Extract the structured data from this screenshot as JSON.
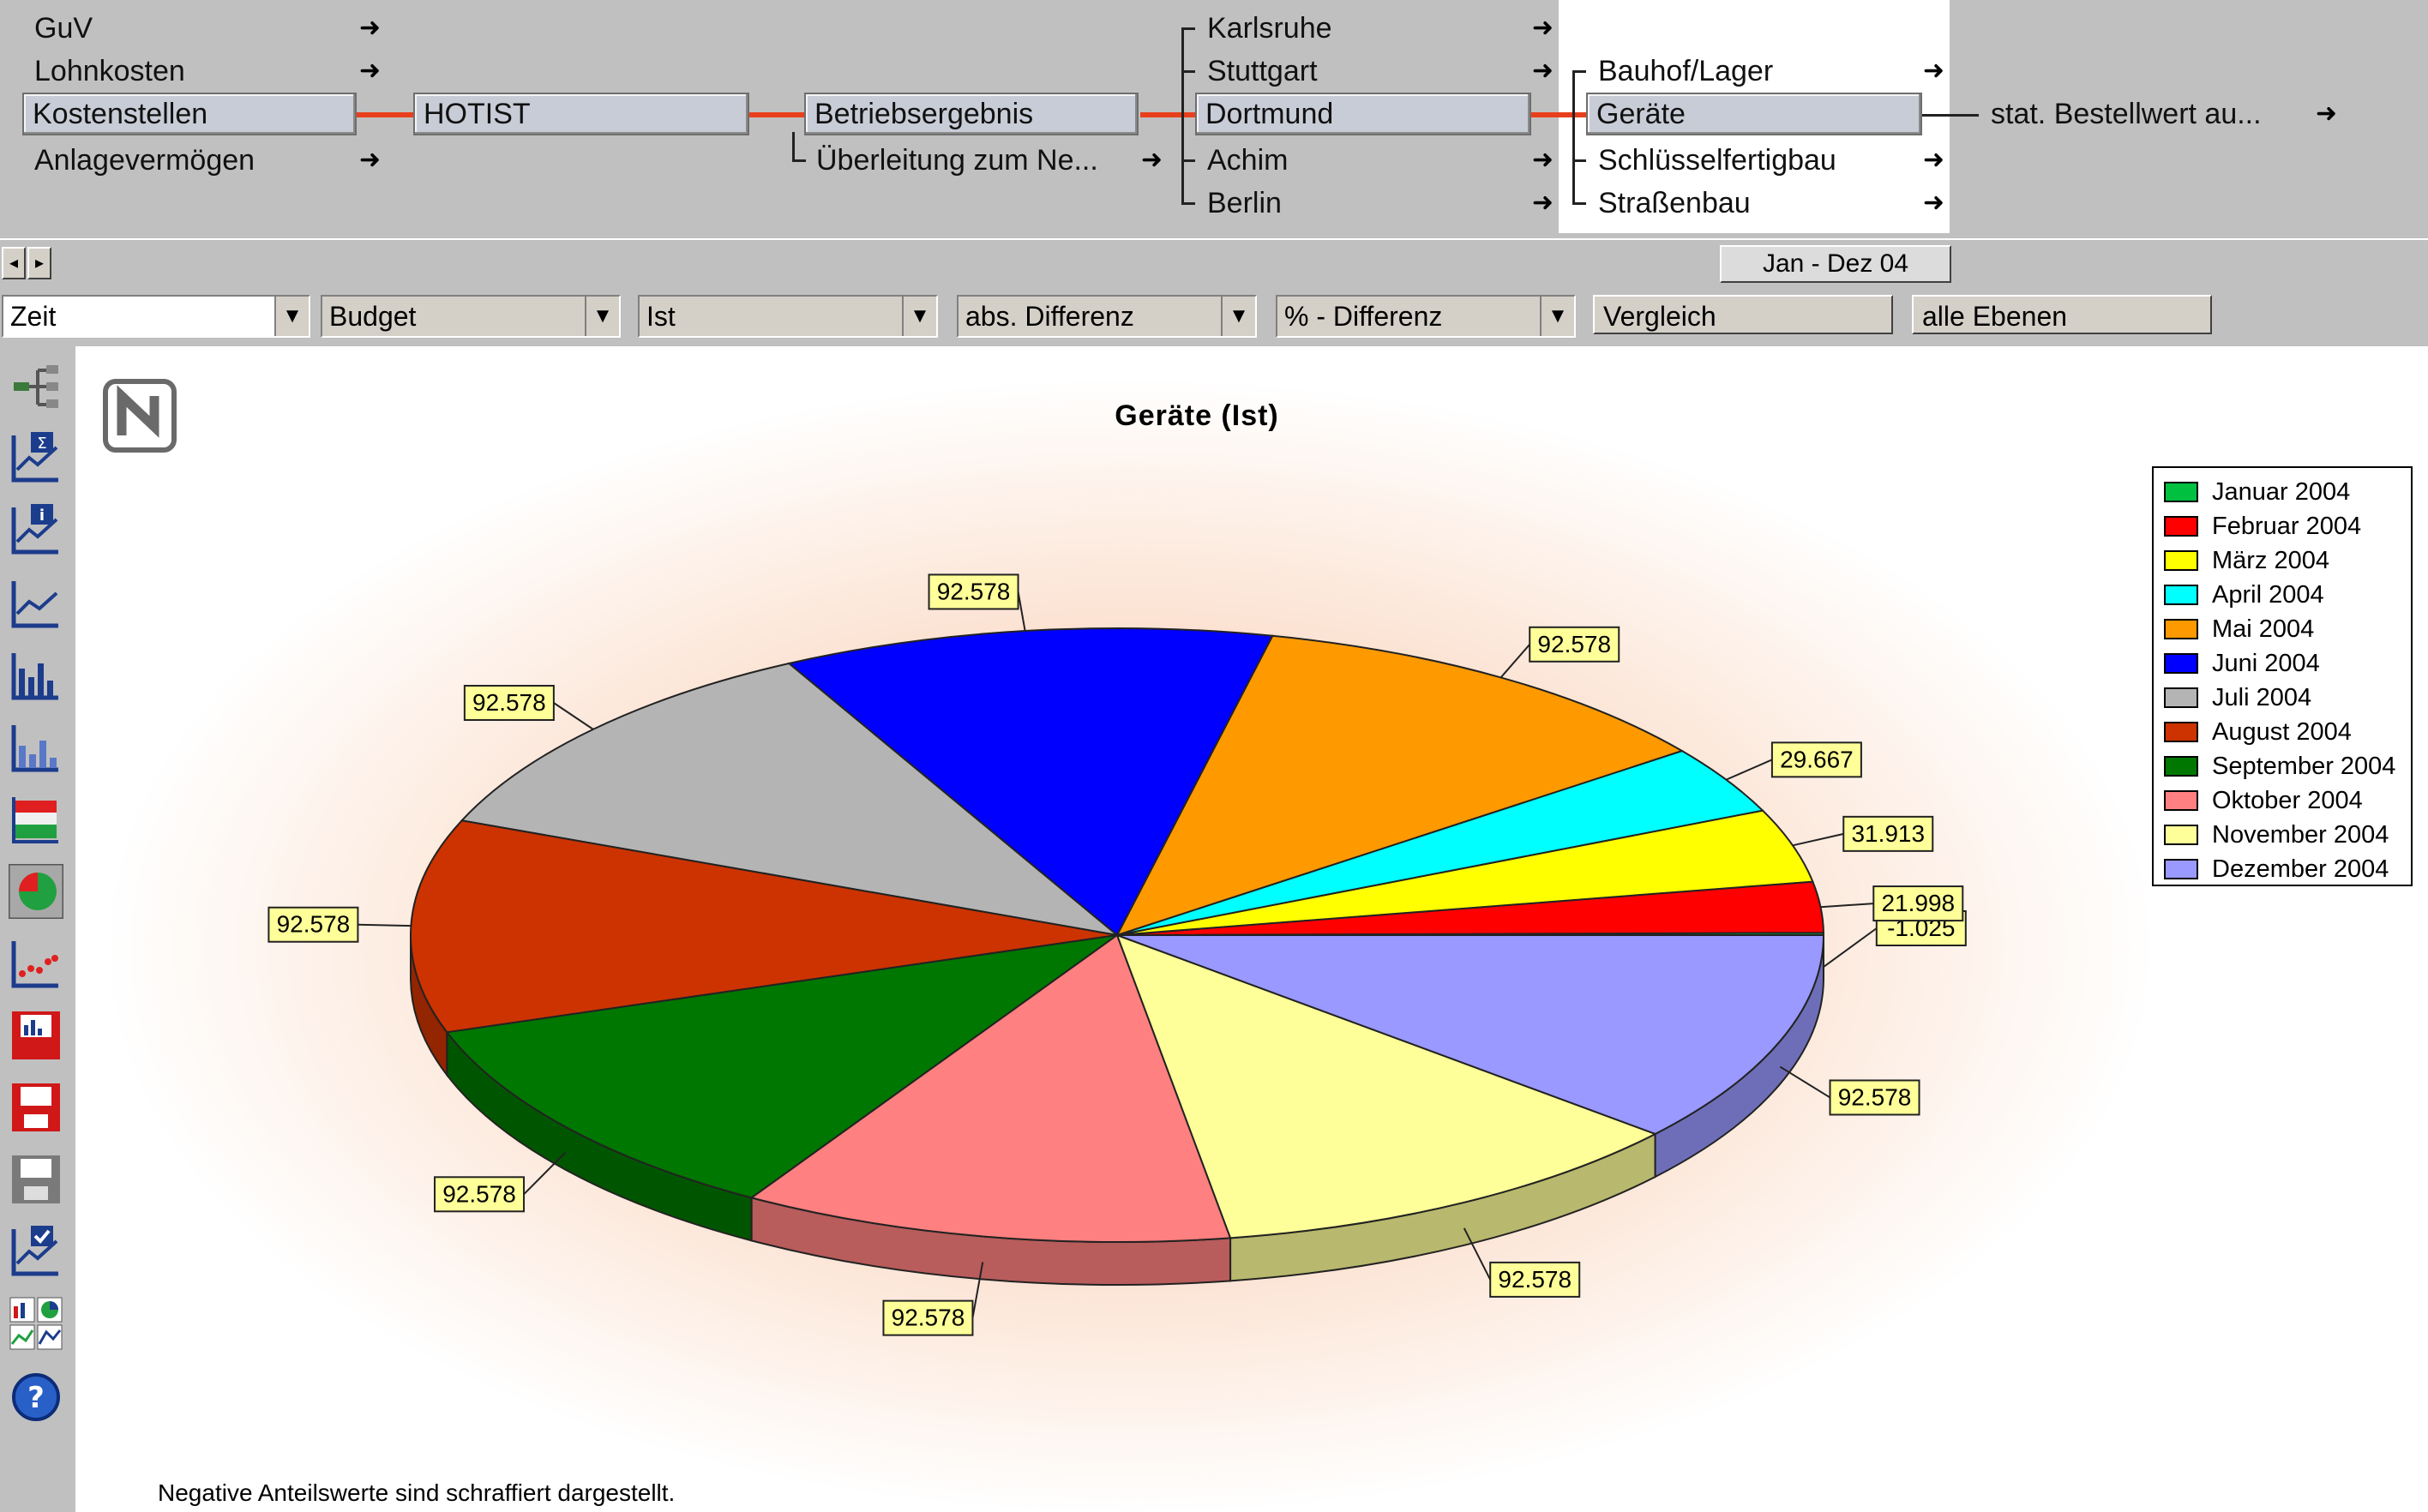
{
  "nav": {
    "col1": [
      {
        "label": "GuV",
        "arrow": true
      },
      {
        "label": "Lohnkosten",
        "arrow": true
      },
      {
        "label": "Kostenstellen",
        "selected": true
      },
      {
        "label": "Anlagevermögen",
        "arrow": true
      }
    ],
    "col2": [
      {
        "label": "HOTIST",
        "selected": true
      }
    ],
    "col3": [
      {
        "label": "Betriebsergebnis",
        "selected": true
      },
      {
        "label": "Überleitung zum Ne...",
        "arrow": true
      }
    ],
    "col4": [
      {
        "label": "Karlsruhe",
        "arrow": true
      },
      {
        "label": "Stuttgart",
        "arrow": true
      },
      {
        "label": "Dortmund",
        "selected": true
      },
      {
        "label": "Achim",
        "arrow": true
      },
      {
        "label": "Berlin",
        "arrow": true
      }
    ],
    "col5": [
      {
        "label": "Bauhof/Lager",
        "arrow": true
      },
      {
        "label": "Geräte",
        "selected": true
      },
      {
        "label": "Schlüsselfertigbau",
        "arrow": true
      },
      {
        "label": "Straßenbau",
        "arrow": true
      }
    ],
    "col6": [
      {
        "label": "stat. Bestellwert au...",
        "arrow": true
      }
    ],
    "arrow_glyph": "➜"
  },
  "date_range": "Jan - Dez 04",
  "toolbar": {
    "dropdowns": [
      {
        "value": "Zeit"
      },
      {
        "value": "Budget"
      },
      {
        "value": "Ist"
      },
      {
        "value": "abs. Differenz"
      },
      {
        "value": "% - Differenz"
      }
    ],
    "buttons": [
      {
        "label": "Vergleich"
      },
      {
        "label": "alle Ebenen"
      }
    ],
    "dropdown_arrow": "▼"
  },
  "palette": [
    {
      "icon": "tree-icon"
    },
    {
      "icon": "chart-sum-icon"
    },
    {
      "icon": "chart-info-icon"
    },
    {
      "icon": "line-chart-icon"
    },
    {
      "icon": "bar-chart-icon"
    },
    {
      "icon": "bar-chart-3d-icon"
    },
    {
      "icon": "stacked-chart-icon"
    },
    {
      "icon": "pie-chart-icon"
    },
    {
      "icon": "scatter-chart-icon"
    },
    {
      "icon": "save-chart-icon"
    },
    {
      "icon": "save-icon"
    },
    {
      "icon": "save-as-icon"
    },
    {
      "icon": "check-chart-icon"
    },
    {
      "icon": "multi-chart-icon"
    },
    {
      "icon": "help-icon"
    }
  ],
  "chart_data": {
    "type": "pie",
    "title": "Geräte (Ist)",
    "categories": [
      "Januar 2004",
      "Februar 2004",
      "März 2004",
      "April 2004",
      "Mai 2004",
      "Juni 2004",
      "Juli 2004",
      "August 2004",
      "September 2004",
      "Oktober 2004",
      "November 2004",
      "Dezember 2004"
    ],
    "values": [
      -1.025,
      21.998,
      31.913,
      29.667,
      92.578,
      92.578,
      92.578,
      92.578,
      92.578,
      92.578,
      92.578,
      92.578
    ],
    "labels": [
      "-1.025",
      "21.998",
      "31.913",
      "29.667",
      "92.578",
      "92.578",
      "92.578",
      "92.578",
      "92.578",
      "92.578",
      "92.578",
      "92.578"
    ],
    "colors": [
      "#00c040",
      "#ff0000",
      "#ffff00",
      "#00ffff",
      "#ff9900",
      "#0000ff",
      "#b4b4b4",
      "#cc3300",
      "#007700",
      "#ff8080",
      "#ffff99",
      "#9999ff"
    ],
    "legend": "right",
    "footnote": "Negative Anteilswerte sind schraffiert dargestellt."
  }
}
